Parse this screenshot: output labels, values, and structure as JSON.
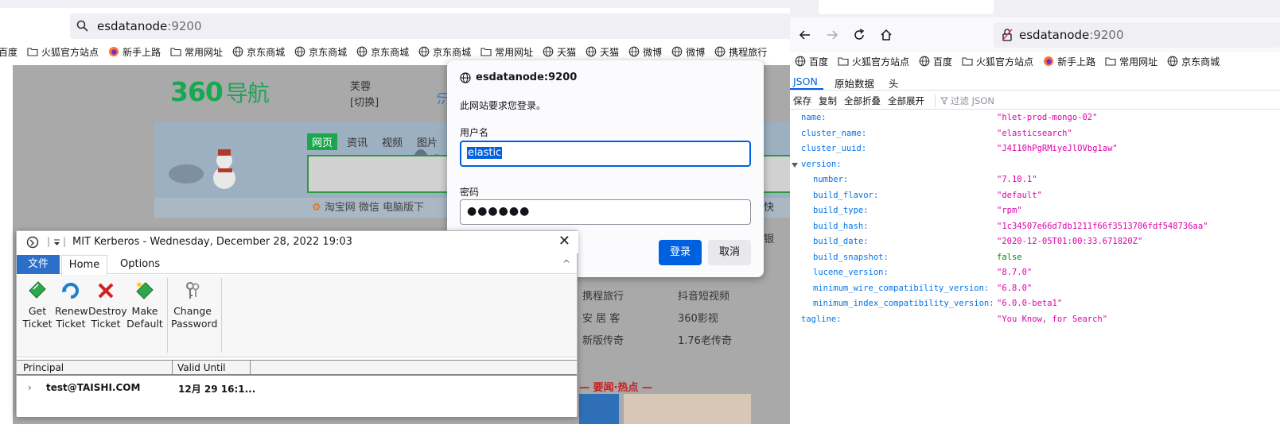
{
  "left_browser": {
    "url_host": "esdatanode",
    "url_port": ":9200",
    "bookmarks": [
      "百度",
      "火狐官方站点",
      "新手上路",
      "常用网址",
      "京东商城",
      "京东商城",
      "京东商城",
      "京东商城",
      "常用网址",
      "天猫",
      "天猫",
      "微博",
      "微博",
      "携程旅行"
    ],
    "page": {
      "logo": "360",
      "logo_cn": "导航",
      "user_name": "芙蓉",
      "user_switch": "[切换]",
      "tabs": [
        "网页",
        "资讯",
        "视频",
        "图片"
      ],
      "links": "淘宝网  微信 电脑版下",
      "grid_col1": [
        "携程旅行",
        "安 居 客",
        "新版传奇"
      ],
      "grid_col2": [
        "抖音短视频",
        "360影视",
        "1.76老传奇"
      ],
      "news_header": "— 要闻·热点 —",
      "edge_right_1": "快",
      "edge_right_2": "银"
    }
  },
  "login_dialog": {
    "title": "esdatanode:9200",
    "message": "此网站要求您登录。",
    "username_label": "用户名",
    "username_value": "elastic",
    "password_label": "密码",
    "password_mask": "●●●●●●",
    "ok_label": "登录",
    "cancel_label": "取消"
  },
  "kerberos": {
    "title": "MIT Kerberos - Wednesday, December 28, 2022  19:03",
    "tabs": {
      "file": "文件",
      "home": "Home",
      "options": "Options"
    },
    "buttons": [
      {
        "label1": "Get",
        "label2": "Ticket"
      },
      {
        "label1": "Renew",
        "label2": "Ticket"
      },
      {
        "label1": "Destroy",
        "label2": "Ticket"
      },
      {
        "label1": "Make",
        "label2": "Default"
      },
      {
        "label1": "Change",
        "label2": "Password"
      }
    ],
    "columns": [
      "Principal",
      "Valid Until"
    ],
    "rows": [
      {
        "principal": "test@TAISHI.COM",
        "valid_until": "12月 29  16:1..."
      }
    ]
  },
  "right_browser": {
    "url_host": "esdatanode",
    "url_port": ":9200",
    "bookmarks": [
      "百度",
      "火狐官方站点",
      "百度",
      "火狐官方站点",
      "新手上路",
      "常用网址",
      "京东商城"
    ],
    "viewer_tabs": [
      "JSON",
      "原始数据",
      "头"
    ],
    "toolbar": [
      "保存",
      "复制",
      "全部折叠",
      "全部展开"
    ],
    "filter_placeholder": "过滤 JSON",
    "json": [
      {
        "key": "name:",
        "value": "\"hlet-prod-mongo-02\"",
        "type": "string",
        "indent": 0
      },
      {
        "key": "cluster_name:",
        "value": "\"elasticsearch\"",
        "type": "string",
        "indent": 0
      },
      {
        "key": "cluster_uuid:",
        "value": "\"J4I10hPgRMiyeJlOVbg1aw\"",
        "type": "string",
        "indent": 0
      },
      {
        "key": "version:",
        "value": "",
        "type": "object",
        "indent": 0
      },
      {
        "key": "number:",
        "value": "\"7.10.1\"",
        "type": "string",
        "indent": 1
      },
      {
        "key": "build_flavor:",
        "value": "\"default\"",
        "type": "string",
        "indent": 1
      },
      {
        "key": "build_type:",
        "value": "\"rpm\"",
        "type": "string",
        "indent": 1
      },
      {
        "key": "build_hash:",
        "value": "\"1c34507e66d7db1211f66f3513706fdf548736aa\"",
        "type": "string",
        "indent": 1
      },
      {
        "key": "build_date:",
        "value": "\"2020-12-05T01:00:33.671820Z\"",
        "type": "string",
        "indent": 1
      },
      {
        "key": "build_snapshot:",
        "value": "false",
        "type": "bool",
        "indent": 1
      },
      {
        "key": "lucene_version:",
        "value": "\"8.7.0\"",
        "type": "string",
        "indent": 1
      },
      {
        "key": "minimum_wire_compatibility_version:",
        "value": "\"6.8.0\"",
        "type": "string",
        "indent": 1
      },
      {
        "key": "minimum_index_compatibility_version:",
        "value": "\"6.0.0-beta1\"",
        "type": "string",
        "indent": 1
      },
      {
        "key": "tagline:",
        "value": "\"You Know, for Search\"",
        "type": "string",
        "indent": 0
      }
    ]
  },
  "colors": {
    "accent": "#0061e0",
    "json_key": "#0074e8",
    "json_string": "#dd00a9",
    "json_bool": "#058b00",
    "logo_green": "#16a951"
  }
}
